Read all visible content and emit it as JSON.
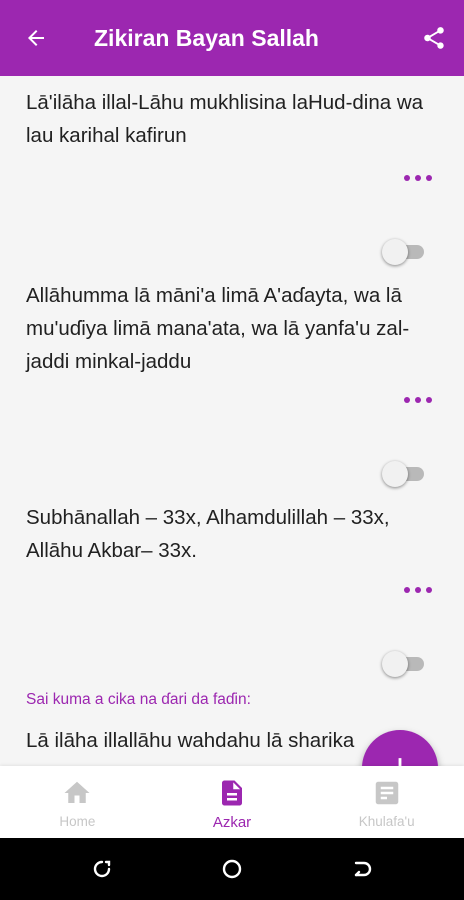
{
  "appbar": {
    "title": "Zikiran Bayan Sallah",
    "back_icon": "arrow-back-icon",
    "share_icon": "share-icon"
  },
  "items": [
    {
      "text": "Lā'ilāha illal-Lāhu mukhlisina laHud-dina wa lau karihal kafirun",
      "enabled": false
    },
    {
      "text": "Allāhumma lā māni'a limā A'aɗayta, wa lā mu'uɗiya limā mana'ata, wa lā yanfa'u zal-jaddi minkal-jaddu",
      "enabled": false
    },
    {
      "text": "Subhānallah – 33x, Alhamdulillah – 33x, Allāhu Akbar– 33x.",
      "enabled": false
    }
  ],
  "subheading": "Sai kuma a cika na ɗari da faɗin:",
  "partial_item": "Lā ilāha illallāhu wahdahu lā sharika",
  "fab_icon": "add-icon",
  "bottom_nav": [
    {
      "label": "Home",
      "icon": "home-icon",
      "active": false
    },
    {
      "label": "Azkar",
      "icon": "document-icon",
      "active": true
    },
    {
      "label": "Khulafa'u",
      "icon": "list-icon",
      "active": false
    }
  ],
  "colors": {
    "primary": "#9c27b0",
    "background": "#f5f5f5",
    "text": "#212121",
    "inactive": "#c7c7c7"
  }
}
